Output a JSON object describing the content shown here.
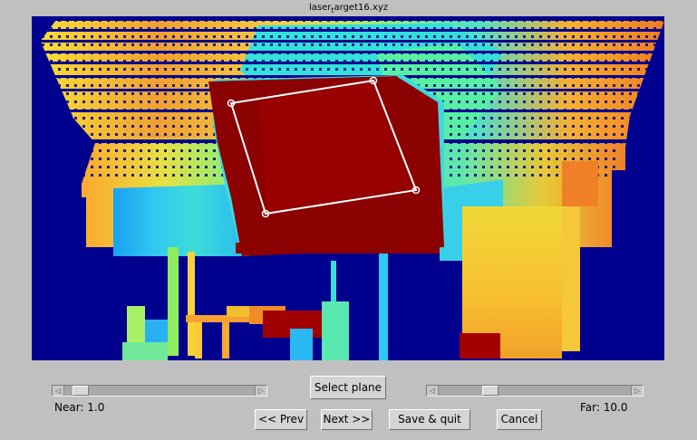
{
  "window": {
    "title_main": "laser",
    "title_sub": "t",
    "title_rest": "arget16.xyz"
  },
  "buttons": {
    "select_plane": "Select plane",
    "prev": "<< Prev",
    "next": "Next >>",
    "save_quit": "Save & quit",
    "cancel": "Cancel"
  },
  "near": {
    "label": "Near: 1.0",
    "level": 0.05
  },
  "far": {
    "label": "Far: 10.0",
    "level": 0.25
  },
  "colors": {
    "background_blue": "#00008f",
    "board_red": "#8b0000",
    "cyan": "#2fd8e8",
    "orange": "#f08c28"
  }
}
